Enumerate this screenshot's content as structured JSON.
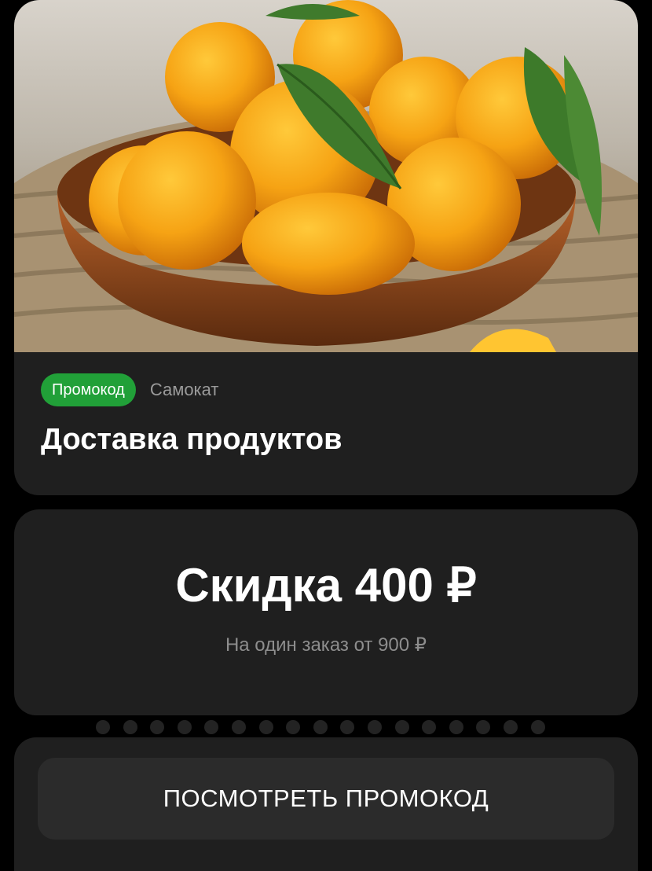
{
  "offer": {
    "badge": "Промокод",
    "partner": "Самокат",
    "title": "Доставка продуктов",
    "image": "tangerines-in-wooden-bowl"
  },
  "ticket": {
    "discount": "Скидка 400 ₽",
    "condition": "На один заказ от 900 ₽",
    "button_label": "ПОСМОТРЕТЬ ПРОМОКОД"
  },
  "colors": {
    "badge_green": "#21a038",
    "card_bg": "#1f1f1f",
    "button_bg": "#2b2b2b",
    "page_bg": "#000000"
  }
}
